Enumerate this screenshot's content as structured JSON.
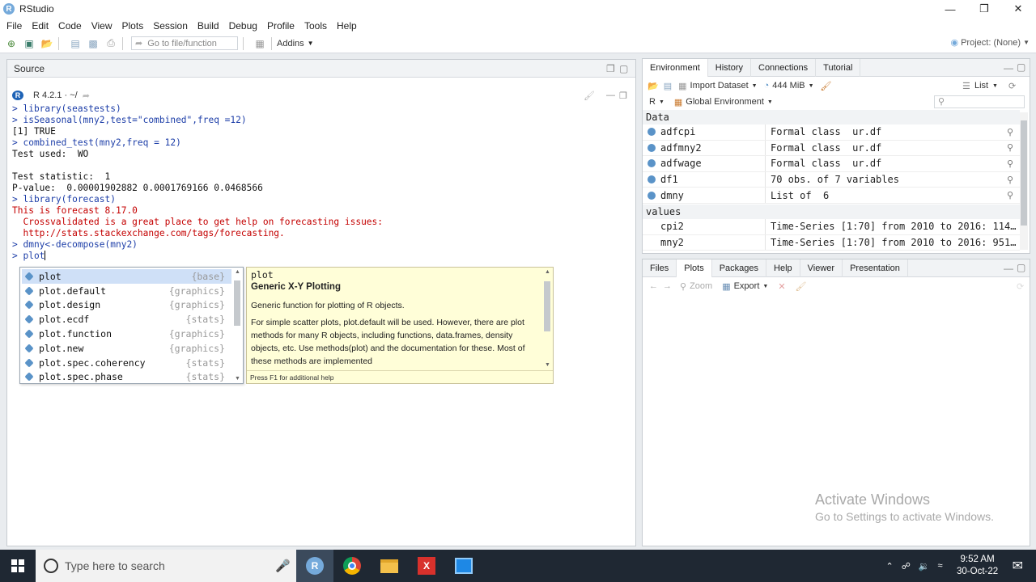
{
  "window": {
    "title": "RStudio",
    "app_icon": "R"
  },
  "menu": [
    "File",
    "Edit",
    "Code",
    "View",
    "Plots",
    "Session",
    "Build",
    "Debug",
    "Profile",
    "Tools",
    "Help"
  ],
  "toolbar": {
    "goto_placeholder": "Go to file/function",
    "addins_label": "Addins",
    "project_label": "Project: (None)"
  },
  "source_pane": {
    "title": "Source"
  },
  "console": {
    "version": "R 4.2.1 · ~/",
    "lines": [
      {
        "text": "> library(seastests)",
        "kind": "cmd"
      },
      {
        "text": "> isSeasonal(mny2,test=\"combined\",freq =12)",
        "kind": "cmd"
      },
      {
        "text": "[1] TRUE",
        "kind": "out"
      },
      {
        "text": "> combined_test(mny2,freq = 12)",
        "kind": "cmd"
      },
      {
        "text": "Test used:  WO",
        "kind": "out"
      },
      {
        "text": "",
        "kind": "out"
      },
      {
        "text": "Test statistic:  1",
        "kind": "out"
      },
      {
        "text": "P-value:  0.00001902882 0.0001769166 0.0468566",
        "kind": "out"
      },
      {
        "text": "> library(forecast)",
        "kind": "cmd"
      },
      {
        "text": "This is forecast 8.17.0",
        "kind": "err"
      },
      {
        "text": "  Crossvalidated is a great place to get help on forecasting issues:",
        "kind": "err"
      },
      {
        "text": "  http://stats.stackexchange.com/tags/forecasting.",
        "kind": "err"
      },
      {
        "text": "> dmny<-decompose(mny2)",
        "kind": "cmd"
      }
    ],
    "prompt": "> plot"
  },
  "autocomplete": [
    {
      "name": "plot",
      "pkg": "{base}"
    },
    {
      "name": "plot.default",
      "pkg": "{graphics}"
    },
    {
      "name": "plot.design",
      "pkg": "{graphics}"
    },
    {
      "name": "plot.ecdf",
      "pkg": "{stats}"
    },
    {
      "name": "plot.function",
      "pkg": "{graphics}"
    },
    {
      "name": "plot.new",
      "pkg": "{graphics}"
    },
    {
      "name": "plot.spec.coherency",
      "pkg": "{stats}"
    },
    {
      "name": "plot.spec.phase",
      "pkg": "{stats}"
    }
  ],
  "help_popup": {
    "fn": "plot",
    "title": "Generic X-Y Plotting",
    "p1": "Generic function for plotting of R objects.",
    "p2": "For simple scatter plots, plot.default will be used. However, there are plot methods for many R objects, including functions, data.frames, density objects, etc. Use methods(plot) and the documentation for these. Most of these methods are implemented",
    "footer": "Press F1 for additional help"
  },
  "env_pane": {
    "tabs": [
      "Environment",
      "History",
      "Connections",
      "Tutorial"
    ],
    "import_label": "Import Dataset",
    "memory": "444 MiB",
    "list_label": "List",
    "lang": "R",
    "scope": "Global Environment",
    "data_header": "Data",
    "values_header": "values",
    "data_rows": [
      {
        "name": "adfcpi",
        "value": "Formal class  ur.df"
      },
      {
        "name": "adfmny2",
        "value": "Formal class  ur.df"
      },
      {
        "name": "adfwage",
        "value": "Formal class  ur.df"
      },
      {
        "name": "df1",
        "value": "70 obs. of 7 variables"
      },
      {
        "name": "dmny",
        "value": "List of  6"
      }
    ],
    "value_rows": [
      {
        "name": "cpi2",
        "value": "Time-Series [1:70] from 2010 to 2016: 114…"
      },
      {
        "name": "mny2",
        "value": "Time-Series [1:70] from 2010 to 2016: 951…"
      }
    ]
  },
  "files_pane": {
    "tabs": [
      "Files",
      "Plots",
      "Packages",
      "Help",
      "Viewer",
      "Presentation"
    ],
    "zoom_label": "Zoom",
    "export_label": "Export"
  },
  "activate": {
    "line1": "Activate Windows",
    "line2": "Go to Settings to activate Windows."
  },
  "taskbar": {
    "search_placeholder": "Type here to search",
    "time": "9:52 AM",
    "date": "30-Oct-22"
  },
  "colors": {
    "accent": "#75aadb",
    "console_cmd": "#1d3ea8",
    "console_err": "#c40000"
  }
}
